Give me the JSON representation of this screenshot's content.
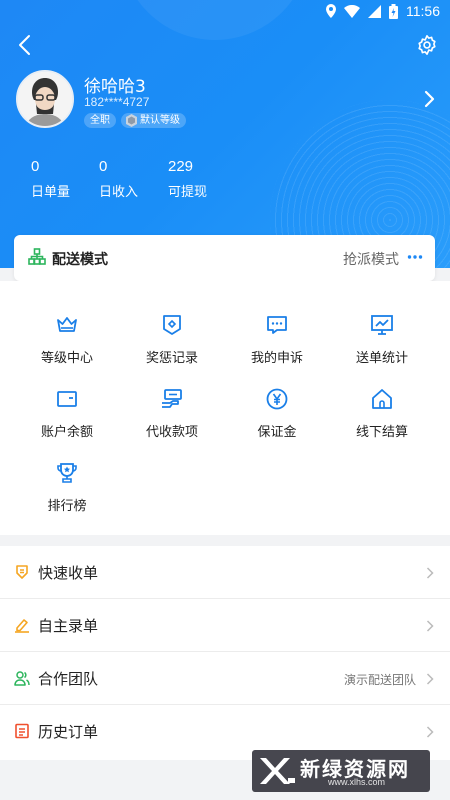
{
  "status_bar": {
    "time": "11:56"
  },
  "profile": {
    "name": "徐哈哈3",
    "phone": "182****4727",
    "job_tag": "全职",
    "level_tag": "默认等级"
  },
  "stats": [
    {
      "value": "0",
      "label": "日单量"
    },
    {
      "value": "0",
      "label": "日收入"
    },
    {
      "value": "229",
      "label": "可提现"
    }
  ],
  "delivery_mode": {
    "title": "配送模式",
    "value": "抢派模式"
  },
  "grid": [
    {
      "label": "等级中心",
      "icon": "crown-icon"
    },
    {
      "label": "奖惩记录",
      "icon": "shield-icon"
    },
    {
      "label": "我的申诉",
      "icon": "chat-icon"
    },
    {
      "label": "送单统计",
      "icon": "chart-icon"
    },
    {
      "label": "账户余额",
      "icon": "wallet-icon"
    },
    {
      "label": "代收款项",
      "icon": "cash-icon"
    },
    {
      "label": "保证金",
      "icon": "yen-icon"
    },
    {
      "label": "线下结算",
      "icon": "home-icon"
    },
    {
      "label": "排行榜",
      "icon": "trophy-icon"
    }
  ],
  "list": [
    {
      "label": "快速收单",
      "extra": "",
      "icon": "fast-receive-icon"
    },
    {
      "label": "自主录单",
      "extra": "",
      "icon": "edit-icon"
    },
    {
      "label": "合作团队",
      "extra": "演示配送团队",
      "icon": "team-icon"
    },
    {
      "label": "历史订单",
      "extra": "",
      "icon": "history-icon"
    }
  ],
  "watermark": {
    "title": "新绿资源网",
    "url": "www.xlhs.com"
  },
  "colors": {
    "primary": "#1e88f5",
    "icon_blue": "#1a7fe8",
    "orange": "#f5a623",
    "green": "#2db55d",
    "red": "#f0502e"
  }
}
